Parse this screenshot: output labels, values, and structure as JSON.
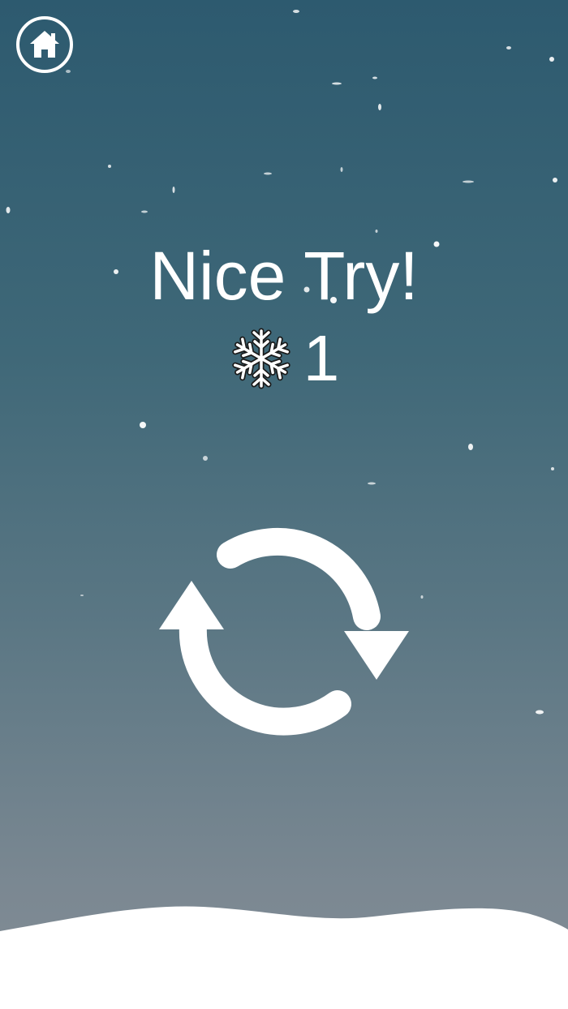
{
  "screen": {
    "background_top": "#2d5a6f",
    "background_bottom": "#838d96",
    "snow_color": "#ffffff"
  },
  "home_button": {
    "icon": "home-icon"
  },
  "result": {
    "title": "Nice Try!",
    "score_icon": "snowflake-icon",
    "score": "1"
  },
  "replay_button": {
    "icon": "replay-arrows-icon"
  }
}
